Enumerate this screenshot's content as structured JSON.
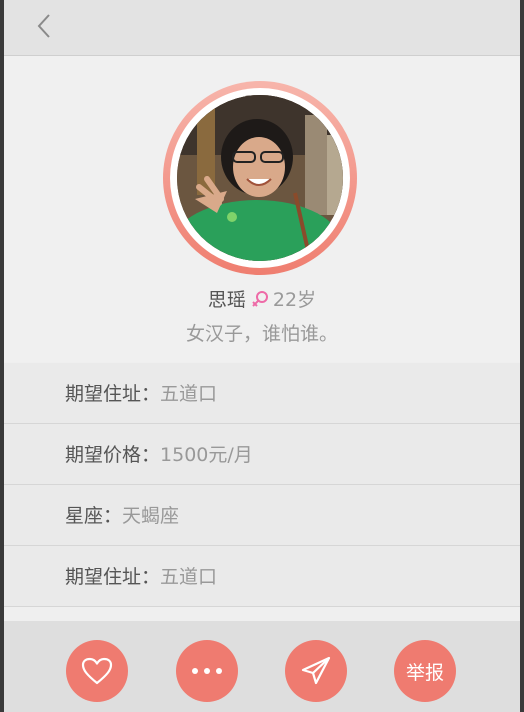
{
  "user": {
    "name": "思瑶",
    "age": "22岁",
    "motto": "女汉子，谁怕谁。"
  },
  "info": {
    "rows": [
      {
        "label": "期望住址：",
        "value": "五道口"
      },
      {
        "label": "期望价格：",
        "value": "1500元/月"
      },
      {
        "label": "星座：",
        "value": "天蝎座"
      },
      {
        "label": "期望住址：",
        "value": "五道口"
      }
    ]
  },
  "actions": {
    "like_icon": "heart-icon",
    "more_icon": "more-dots-icon",
    "send_icon": "paper-plane-icon",
    "report_label": "举报"
  },
  "colors": {
    "accent": "#ef7b70",
    "gender": "#ee6aa7"
  },
  "icons": {
    "back": "chevron-left-icon",
    "gender": "female-icon"
  }
}
